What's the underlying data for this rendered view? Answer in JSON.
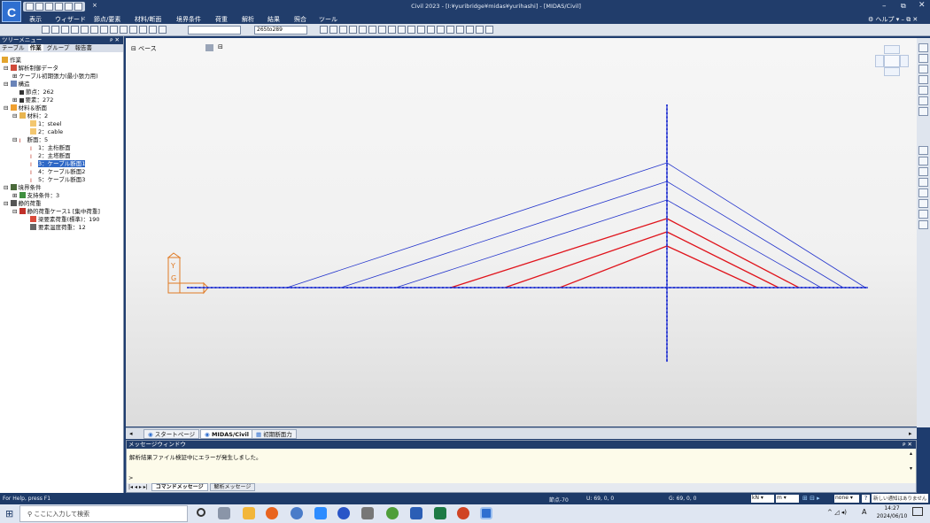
{
  "app": {
    "title": "Civil 2023 - [I:¥yuribridge¥midas¥yurihashi] - [MIDAS/Civil]",
    "logo": "C"
  },
  "menu": [
    "表示",
    "ウィザード",
    "節点/要素",
    "材料/断面",
    "境界条件",
    "荷重",
    "解析",
    "結果",
    "照合",
    "ツール"
  ],
  "help": "ヘルプ",
  "toolbar": {
    "field1": "",
    "field2": "265to289"
  },
  "tree": {
    "title": "ツリーメニュー",
    "pin": "ᴘ ✕",
    "tabs": [
      "テーブル",
      "作業",
      "グループ",
      "報告書"
    ],
    "items": [
      "作業",
      "解析制御データ",
      "ケーブル初期張力(最小張力用)",
      "構造",
      "節点：262",
      "要素：272",
      "材料＆断面",
      "材料：2",
      "1：steel",
      "2：cable",
      "断面：5",
      "1：主桁断面",
      "2：主塔断面",
      "3：ケーブル断面1",
      "4：ケーブル断面2",
      "5：ケーブル断面3",
      "境界条件",
      "支持条件：3",
      "静的荷重",
      "静的荷重ケース1 [集中荷重]",
      "梁要素荷重(標準)：190",
      "要素温度荷重：12"
    ]
  },
  "view": {
    "label": "ベース",
    "axis_y": "Y",
    "axis_g": "G"
  },
  "tabs": [
    "スタートページ",
    "MIDAS/Civil",
    "初期断面力"
  ],
  "message": {
    "title": "メッセージウィンドウ",
    "line": "解析結果ファイル検証中にエラーが発生しました。",
    "prompt": ">",
    "tabs": [
      "コマンドメッセージ",
      "解析メッセージ"
    ]
  },
  "status": {
    "help": "For Help, press F1",
    "node": "節点-70",
    "u": "U: 69, 0, 0",
    "g": "G: 69, 0, 0",
    "unit1": "kN",
    "unit2": "m",
    "none": "none",
    "notice": "新しい通知はありません"
  },
  "taskbar": {
    "search": "ここに入力して検索",
    "time": "14:27",
    "date": "2024/06/10",
    "lang": "A"
  },
  "colors": {
    "accent": "#213d6b",
    "deck": "#1a2bd0",
    "cable_blue": "#2233cc",
    "cable_red": "#e0141c"
  }
}
